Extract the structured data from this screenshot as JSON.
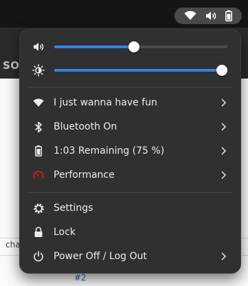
{
  "background_app": {
    "header_text": "SOU",
    "snippet_text": "cha",
    "link_text": "#2"
  },
  "topbar": {
    "status_icons": [
      "wifi-icon",
      "volume-icon",
      "battery-icon"
    ]
  },
  "quick_settings": {
    "volume": {
      "icon": "volume-icon",
      "level": 0.46
    },
    "brightness": {
      "icon": "brightness-icon",
      "level": 1.0
    },
    "items": [
      {
        "id": "wifi",
        "icon": "wifi-icon",
        "label": "I just wanna have fun",
        "has_submenu": true
      },
      {
        "id": "bluetooth",
        "icon": "bluetooth-icon",
        "label": "Bluetooth On",
        "has_submenu": true
      },
      {
        "id": "battery",
        "icon": "battery-icon",
        "label": "1:03 Remaining (75 %)",
        "has_submenu": true
      },
      {
        "id": "performance",
        "icon": "performance-icon",
        "label": "Performance",
        "has_submenu": true
      },
      {
        "id": "settings",
        "icon": "settings-icon",
        "label": "Settings",
        "has_submenu": false
      },
      {
        "id": "lock",
        "icon": "lock-icon",
        "label": "Lock",
        "has_submenu": false
      },
      {
        "id": "power",
        "icon": "power-icon",
        "label": "Power Off / Log Out",
        "has_submenu": true
      }
    ]
  },
  "colors": {
    "accent": "#3584e4",
    "panel_bg": "#303030",
    "text": "#ededed",
    "performance_icon": "#e01b24"
  }
}
